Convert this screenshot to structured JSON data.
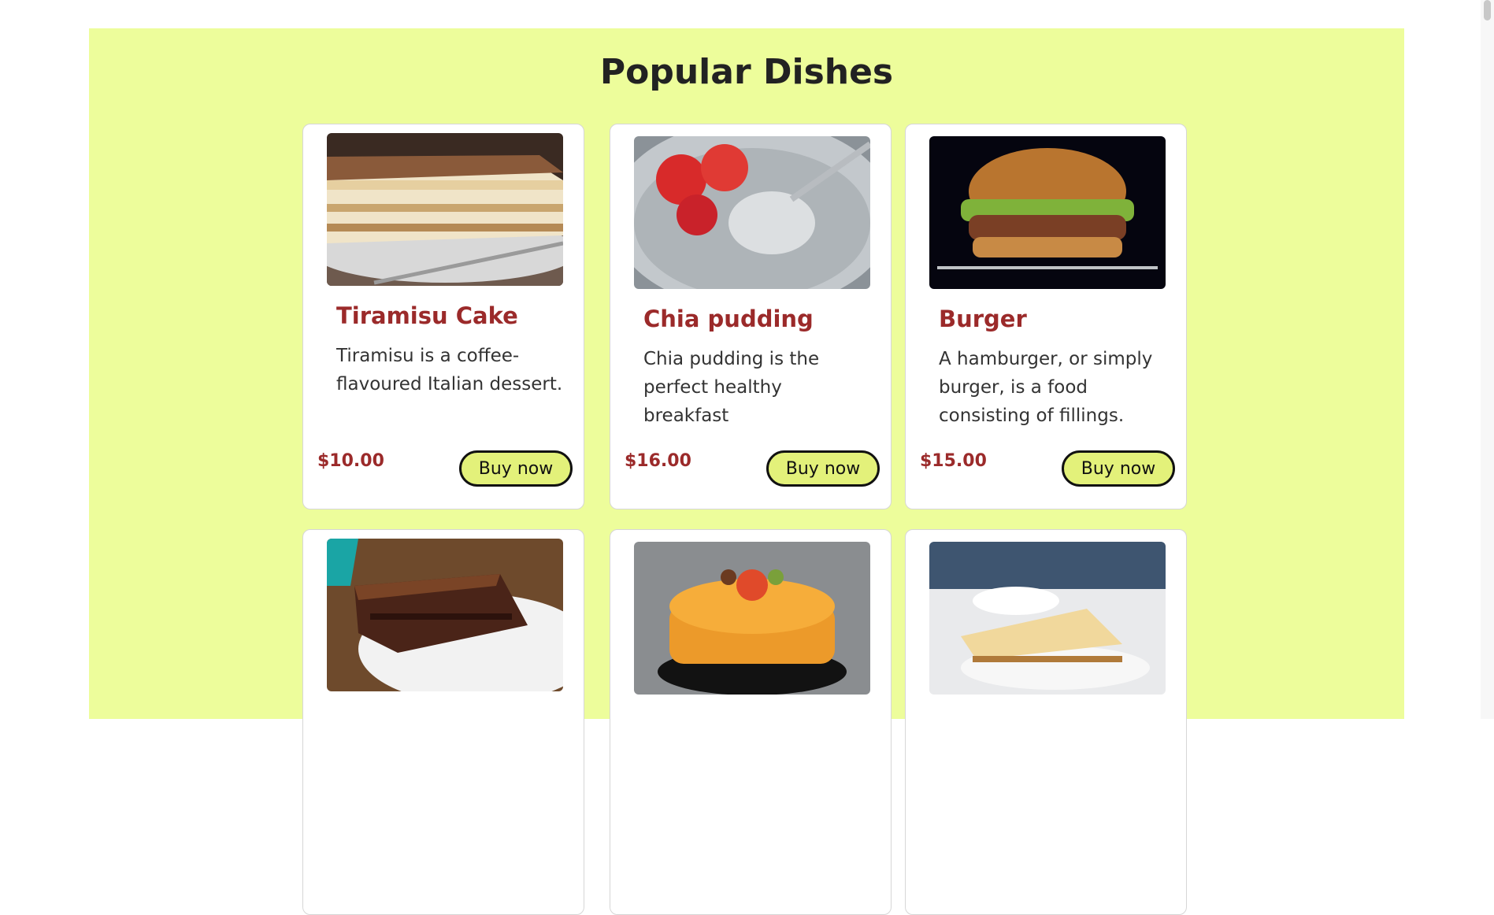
{
  "page": {
    "title": "Popular Dishes",
    "accent_bg": "#edfd9b",
    "accent_text": "#9b2a2a",
    "button_bg": "#e3f17a"
  },
  "cards": [
    {
      "name": "Tiramisu Cake",
      "description": "Tiramisu is a coffee-flavoured Italian dessert.",
      "price": "$10.00",
      "button": "Buy now",
      "image_icon": "tiramisu-image"
    },
    {
      "name": "Chia pudding",
      "description": "Chia pudding is the perfect healthy breakfast",
      "price": "$16.00",
      "button": "Buy now",
      "image_icon": "chia-pudding-image"
    },
    {
      "name": "Burger",
      "description": "A hamburger, or simply burger, is a food consisting of fillings.",
      "price": "$15.00",
      "button": "Buy now",
      "image_icon": "burger-image"
    },
    {
      "image_icon": "chocolate-cake-image"
    },
    {
      "image_icon": "orange-cake-image"
    },
    {
      "image_icon": "cheesecake-image"
    }
  ]
}
